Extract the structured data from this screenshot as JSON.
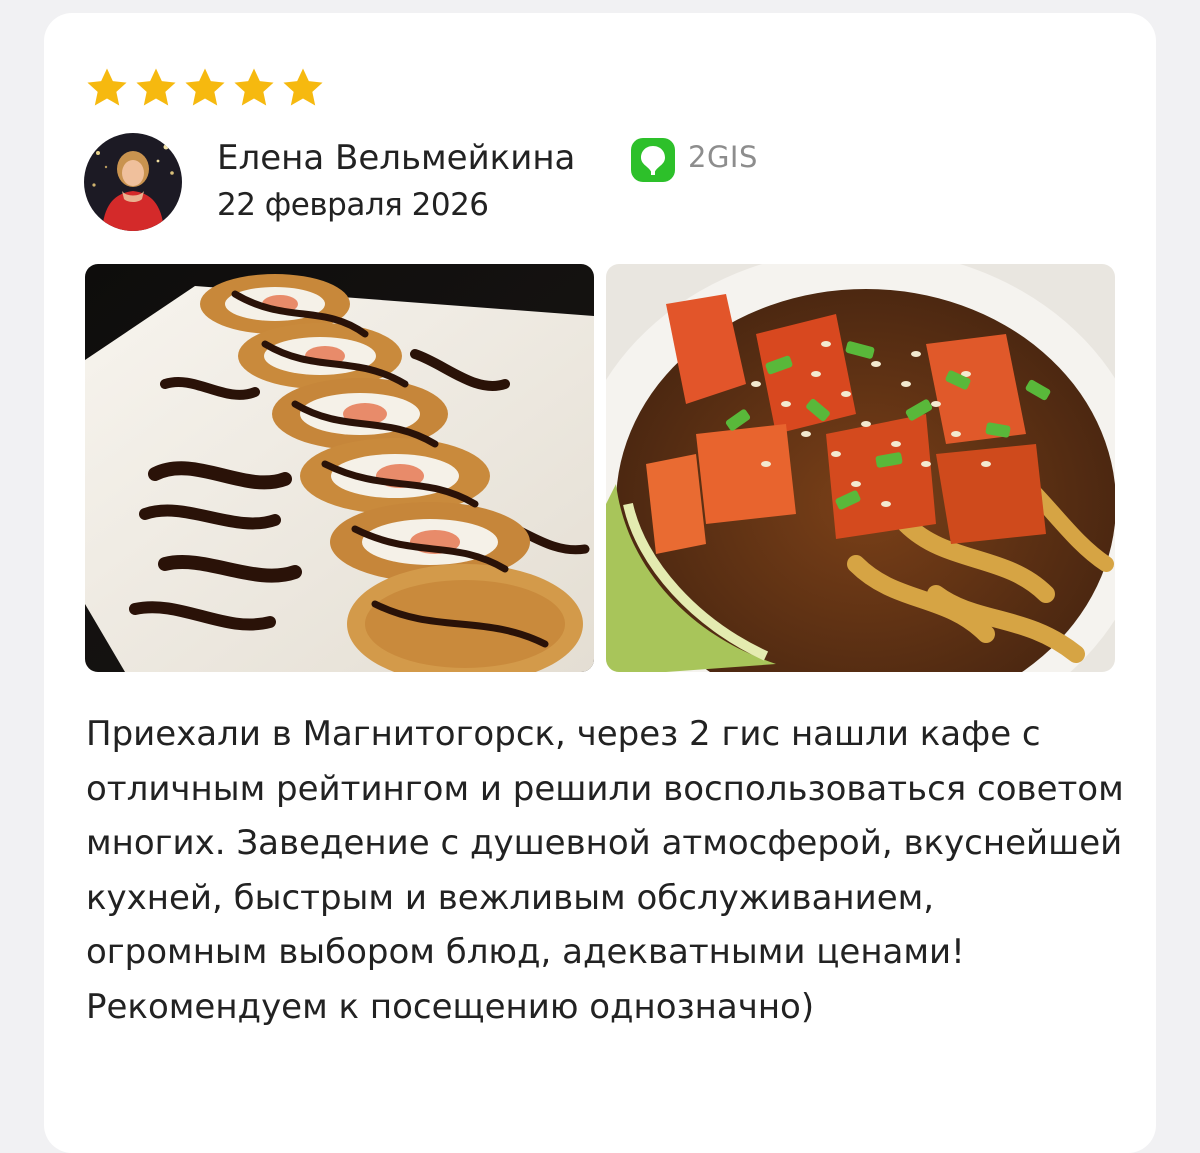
{
  "review": {
    "rating": 5,
    "max_rating": 5,
    "star_color": "#f6b90f",
    "author": "Елена Вельмейкина",
    "date": "22 февраля 2026",
    "source": {
      "name": "2GIS",
      "icon": "2gis-logo-icon",
      "color": "#2dc02a"
    },
    "photos": [
      {
        "icon": "sushi-rolls-photo"
      },
      {
        "icon": "udon-noodles-photo"
      }
    ],
    "text": "Приехали в Магнитогорск, через 2 гис нашли кафе с отличным рейтингом и решили воспользоваться советом многих. Заведение с душевной атмосферой, вкуснейшей кухней, быстрым и вежливым обслуживанием, огромным выбором блюд, адекватными ценами! Рекомендуем к посещению однозначно)"
  }
}
